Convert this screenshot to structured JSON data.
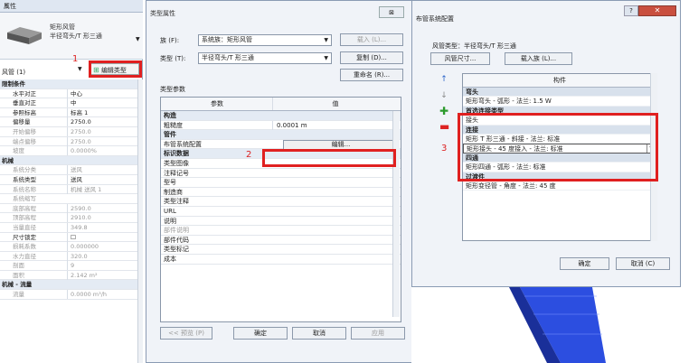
{
  "properties_panel": {
    "title": "属性",
    "close": "✕",
    "family_line1": "矩形风管",
    "family_line2": "半径弯头/T 形三通",
    "filter_label": "风管 (1)",
    "edit_type_label": "编辑类型",
    "marker": "1",
    "rows": [
      {
        "k": "限制条件",
        "v": "",
        "sec": true
      },
      {
        "k": "水平对正",
        "v": "中心"
      },
      {
        "k": "垂直对正",
        "v": "中"
      },
      {
        "k": "参照标高",
        "v": "标高 1"
      },
      {
        "k": "偏移量",
        "v": "2750.0"
      },
      {
        "k": "开始偏移",
        "v": "2750.0",
        "grey": true
      },
      {
        "k": "端点偏移",
        "v": "2750.0",
        "grey": true
      },
      {
        "k": "坡度",
        "v": "0.0000%",
        "grey": true
      },
      {
        "k": "机械",
        "v": "",
        "sec": true
      },
      {
        "k": "系统分类",
        "v": "送风",
        "grey": true
      },
      {
        "k": "系统类型",
        "v": "送风"
      },
      {
        "k": "系统名称",
        "v": "机械 送风 1",
        "grey": true
      },
      {
        "k": "系统缩写",
        "v": "",
        "grey": true
      },
      {
        "k": "底部高程",
        "v": "2590.0",
        "grey": true
      },
      {
        "k": "顶部高程",
        "v": "2910.0",
        "grey": true
      },
      {
        "k": "当量直径",
        "v": "349.8",
        "grey": true
      },
      {
        "k": "尺寸锁定",
        "v": "☐"
      },
      {
        "k": "损耗系数",
        "v": "0.000000",
        "grey": true
      },
      {
        "k": "水力直径",
        "v": "320.0",
        "grey": true
      },
      {
        "k": "剖面",
        "v": "9",
        "grey": true
      },
      {
        "k": "面积",
        "v": "2.142 m²",
        "grey": true
      },
      {
        "k": "机械 - 流量",
        "v": "",
        "sec": true
      },
      {
        "k": "流量",
        "v": "0.0000 m³/h",
        "grey": true
      }
    ]
  },
  "type_properties": {
    "title": "类型属性",
    "close": "⊠",
    "family_label": "族 (F):",
    "family_value": "系统族：矩形风管",
    "load_button": "载入 (L)...",
    "type_label": "类型 (T):",
    "type_value": "半径弯头/T 形三通",
    "duplicate_button": "复制 (D)...",
    "rename_button": "重命名 (R)...",
    "params_heading": "类型参数",
    "col_param": "参数",
    "col_value": "值",
    "rows": [
      {
        "k": "构造",
        "v": "",
        "sec": true
      },
      {
        "k": "粗糙度",
        "v": "0.0001 m"
      },
      {
        "k": "管件",
        "v": "",
        "sec": true
      },
      {
        "k": "布管系统配置",
        "v": "",
        "edit": true
      },
      {
        "k": "标识数据",
        "v": "",
        "sec": true
      },
      {
        "k": "类型图像",
        "v": ""
      },
      {
        "k": "注释记号",
        "v": ""
      },
      {
        "k": "型号",
        "v": ""
      },
      {
        "k": "制造商",
        "v": ""
      },
      {
        "k": "类型注释",
        "v": ""
      },
      {
        "k": "URL",
        "v": ""
      },
      {
        "k": "说明",
        "v": ""
      },
      {
        "k": "部件说明",
        "v": "",
        "grey": true
      },
      {
        "k": "部件代码",
        "v": ""
      },
      {
        "k": "类型标记",
        "v": ""
      },
      {
        "k": "成本",
        "v": ""
      }
    ],
    "edit_button": "编辑...",
    "marker": "2",
    "preview_button": "<< 预览 (P)",
    "ok_button": "确定",
    "cancel_button": "取消",
    "apply_button": "应用"
  },
  "routing_prefs": {
    "title": "布管系统配置",
    "help": "?",
    "close": "✕",
    "duct_type": "风管类型：半径弯头/T 形三通",
    "duct_size_button": "风管尺寸...",
    "load_family_button": "载入族 (L)...",
    "col_header": "构件",
    "marker": "3",
    "rows": [
      {
        "t": "弯头",
        "sec": true
      },
      {
        "t": "矩形弯头 - 弧形 - 法兰: 1.5 W"
      },
      {
        "t": "首选连接类型",
        "sec": true
      },
      {
        "t": "接头"
      },
      {
        "t": "连接",
        "sec": true
      },
      {
        "t": "矩形 T 形三通 - 斜接 - 法兰: 标准"
      },
      {
        "t": "矩形接头 - 45 度接入 - 法兰: 标准",
        "sel": true
      },
      {
        "t": "四通",
        "sec": true
      },
      {
        "t": "矩形四通 - 弧形 - 法兰: 标准"
      },
      {
        "t": "过渡件",
        "sec": true
      },
      {
        "t": "矩形变径管 - 角度 - 法兰: 45 度"
      }
    ],
    "ok_button": "确定",
    "cancel_button": "取消 (C)"
  }
}
